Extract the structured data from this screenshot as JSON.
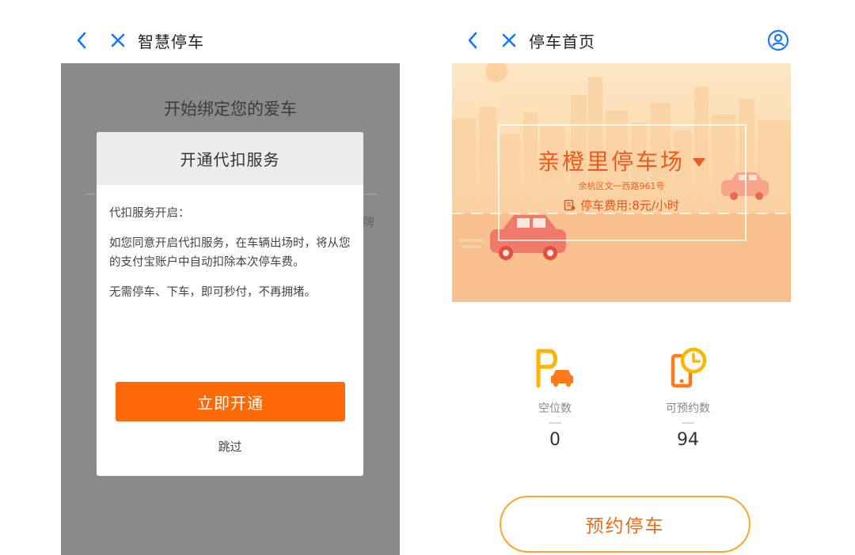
{
  "left_screen": {
    "nav": {
      "title": "智慧停车"
    },
    "background": {
      "title": "开始绑定您的爱车",
      "edge_char": "牌"
    },
    "modal": {
      "title": "开通代扣服务",
      "paragraphs": [
        "代扣服务开启：",
        "如您同意开启代扣服务，在车辆出场时，将从您的支付宝账户中自动扣除本次停车费。",
        "无需停车、下车，即可秒付，不再拥堵。"
      ],
      "confirm_label": "立即开通",
      "skip_label": "跳过"
    }
  },
  "right_screen": {
    "nav": {
      "title": "停车首页"
    },
    "lot": {
      "name": "亲橙里停车场",
      "address": "余杭区文一西路961号",
      "fee": "停车费用:8元/小时"
    },
    "stats": [
      {
        "label": "空位数",
        "value": "0",
        "icon": "parking-car-icon"
      },
      {
        "label": "可预约数",
        "value": "94",
        "icon": "phone-clock-icon"
      }
    ],
    "reserve_label": "预约停车"
  },
  "colors": {
    "accent_orange": "#ff6a09",
    "lot_title_orange": "#f0591d",
    "stat_icon_yellow": "#ffb400",
    "stat_icon_orange": "#ff7a1a",
    "reserve_border": "#ffa42a",
    "nav_icon_blue": "#1677ff",
    "overlay_gray": "#8a8a8a"
  }
}
